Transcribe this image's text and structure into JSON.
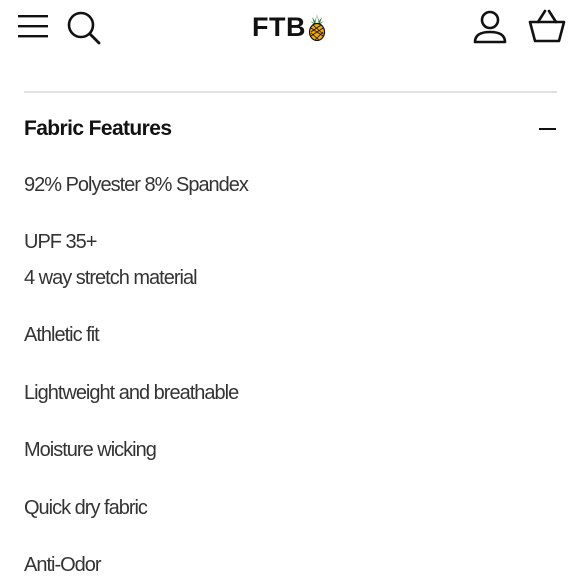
{
  "header": {
    "logo_text": "FTB",
    "icons": {
      "menu": "hamburger-menu-icon",
      "search": "search-icon",
      "account": "user-account-icon",
      "cart": "shopping-basket-icon",
      "logo_mark": "pineapple-icon"
    }
  },
  "section": {
    "title": "Fabric Features",
    "toggle_icon": "minus-icon",
    "features": [
      "92% Polyester 8% Spandex",
      "UPF 35+",
      "4 way stretch material",
      "Athletic fit",
      "Lightweight and breathable",
      "Moisture wicking",
      "Quick dry fabric",
      "Anti-Odor"
    ]
  },
  "colors": {
    "text": "#111111",
    "body_text": "#333333",
    "divider": "#e0e0e0",
    "pineapple_body": "#f2a900",
    "pineapple_leaves": "#2e7d32"
  }
}
